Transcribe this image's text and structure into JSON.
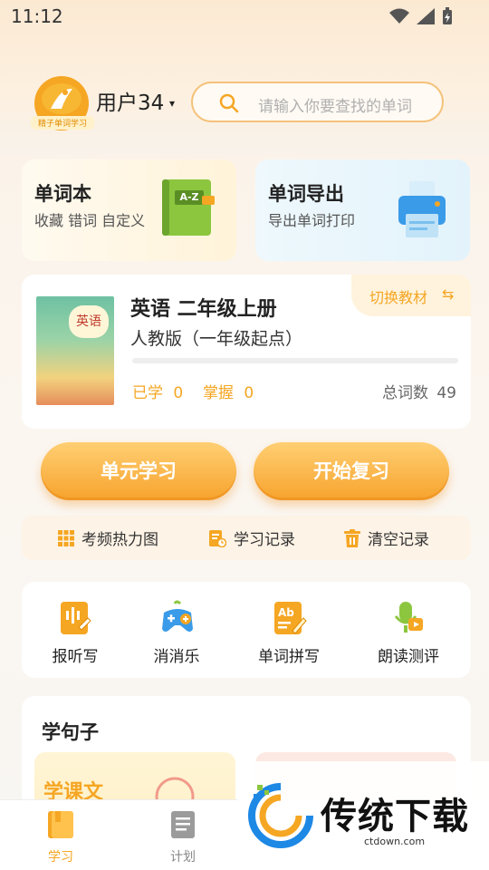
{
  "status": {
    "time": "11:12"
  },
  "header": {
    "username": "用户34",
    "caret": "▾",
    "avatar_caption": "精子单词学习",
    "search_placeholder": "请输入你要查找的单词"
  },
  "cards": {
    "vocab": {
      "title": "单词本",
      "subtitle": "收藏 错词 自定义",
      "icon_text": "A-Z"
    },
    "export": {
      "title": "单词导出",
      "subtitle": "导出单词打印"
    }
  },
  "book": {
    "title": "英语 二年级上册",
    "edition": "人教版（一年级起点）",
    "cover_text": "英语",
    "switch_label": "切换教材",
    "switch_icon": "⇆",
    "learned_label": "已学",
    "learned_value": "0",
    "mastered_label": "掌握",
    "mastered_value": "0",
    "total_label": "总词数",
    "total_value": "49",
    "progress": 0
  },
  "buttons": {
    "unit_study": "单元学习",
    "start_review": "开始复习"
  },
  "quick_links": [
    {
      "label": "考频热力图",
      "icon": "grid-icon"
    },
    {
      "label": "学习记录",
      "icon": "record-icon"
    },
    {
      "label": "清空记录",
      "icon": "trash-icon"
    }
  ],
  "tools": [
    {
      "label": "报听写",
      "icon": "dictation-icon"
    },
    {
      "label": "消消乐",
      "icon": "gamepad-icon"
    },
    {
      "label": "单词拼写",
      "icon": "spelling-icon"
    },
    {
      "label": "朗读测评",
      "icon": "microphone-icon"
    }
  ],
  "sentences": {
    "title": "学句子",
    "tile1": "学课文"
  },
  "nav": [
    {
      "label": "学习",
      "icon": "book-icon",
      "active": true
    },
    {
      "label": "计划",
      "icon": "plan-icon",
      "active": false
    }
  ],
  "watermark": {
    "text": "传统下载",
    "url": "ctdown.com"
  },
  "colors": {
    "accent": "#f5a623",
    "text": "#222222",
    "muted": "#b0b0b0"
  }
}
